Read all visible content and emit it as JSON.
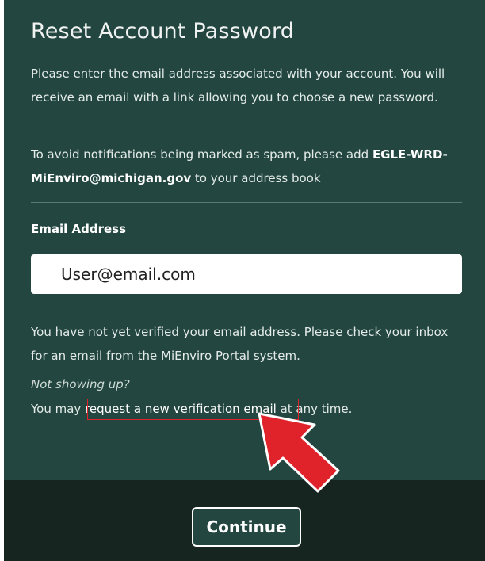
{
  "form": {
    "title": "Reset Account Password",
    "intro": "Please enter the email address associated with your account. You will receive an email with a link allowing you to choose a new password.",
    "spam_prefix": "To avoid notifications being marked as spam, please add ",
    "spam_email": "EGLE-WRD-MiEnviro@michigan.gov",
    "spam_suffix": " to your address book",
    "email_label": "Email Address",
    "email_value": "User@email.com",
    "verify_message": "You have not yet verified your email address. Please check your inbox for an email from the MiEnviro Portal system.",
    "not_showing": "Not showing up?",
    "request_prefix": "You may ",
    "request_link": "request a new verification email",
    "request_suffix": " at any time.",
    "continue_label": "Continue"
  },
  "annotation": {
    "highlight_color": "#e0222a",
    "arrow_color": "#e0222a"
  },
  "colors": {
    "panel_bg": "#234740",
    "footer_bg": "#172521"
  }
}
